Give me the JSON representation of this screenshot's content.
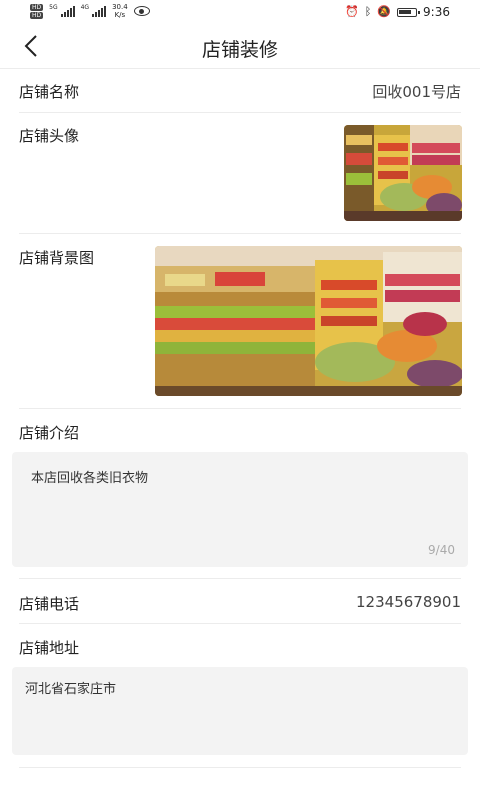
{
  "status_bar": {
    "hd1": "HD",
    "hd2": "HD",
    "net1": "5G",
    "net2": "4G",
    "speed_value": "30.4",
    "speed_unit": "K/s",
    "time": "9:36"
  },
  "header": {
    "title": "店铺装修"
  },
  "shop_name": {
    "label": "店铺名称",
    "value": "回收001号店"
  },
  "shop_avatar": {
    "label": "店铺头像"
  },
  "shop_background": {
    "label": "店铺背景图"
  },
  "shop_intro": {
    "label": "店铺介绍",
    "value": "本店回收各类旧衣物",
    "counter": "9/40"
  },
  "shop_phone": {
    "label": "店铺电话",
    "value": "12345678901"
  },
  "shop_address": {
    "label": "店铺地址",
    "value": "河北省石家庄市"
  },
  "colors": {
    "divider": "#ececec",
    "textbox_bg": "#f3f3f3",
    "counter": "#aaaaaa"
  }
}
